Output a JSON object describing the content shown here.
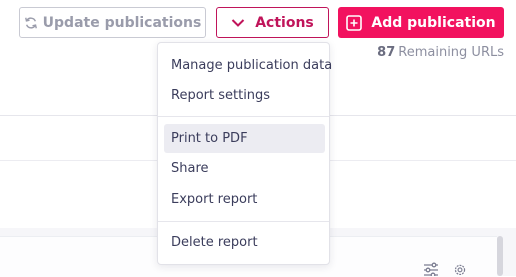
{
  "toolbar": {
    "update_label": "Update publications",
    "actions_label": "Actions",
    "add_label": "Add publication"
  },
  "remaining": {
    "count": "87",
    "label": "Remaining URLs"
  },
  "actions_menu": {
    "items": [
      {
        "label": "Manage publication data"
      },
      {
        "label": "Report settings"
      },
      {
        "label": "Print to PDF"
      },
      {
        "label": "Share"
      },
      {
        "label": "Export report"
      },
      {
        "label": "Delete report"
      }
    ],
    "highlighted": "Print to PDF"
  },
  "icons": {
    "update": "refresh-icon",
    "actions": "chevron-down-icon",
    "add": "plus-square-icon",
    "filter": "sliders-icon",
    "settings": "gear-icon"
  },
  "colors": {
    "accent": "#f2125f",
    "accent_dark": "#c0145a",
    "muted_text": "#9a9cab",
    "menu_hover": "#ececf2"
  }
}
